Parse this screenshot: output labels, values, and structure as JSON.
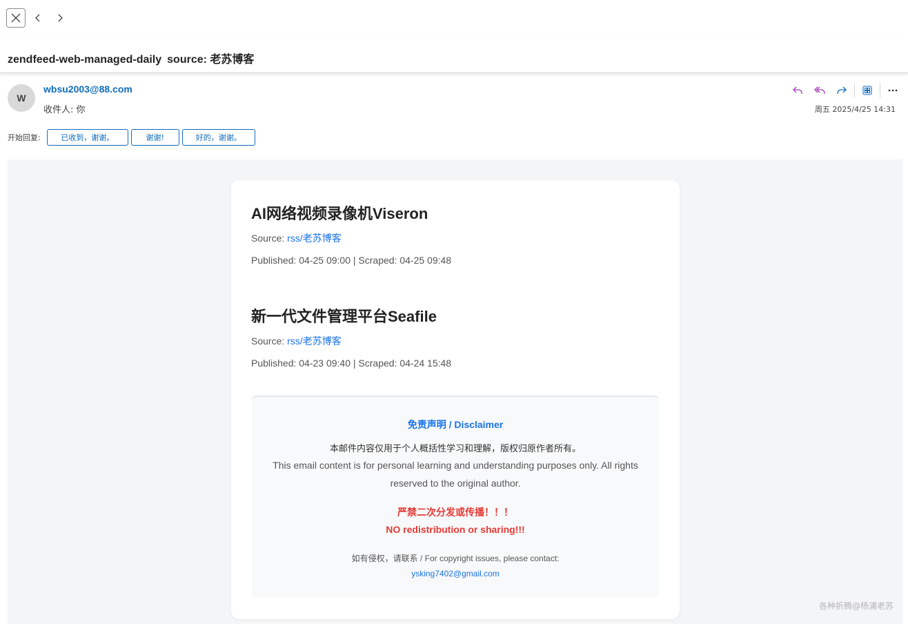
{
  "subject": {
    "title": "zendfeed-web-managed-daily",
    "source": "source: 老苏博客"
  },
  "header": {
    "avatar_initial": "W",
    "sender": "wbsu2003@88.com",
    "recipients": "收件人: 你",
    "datetime": "周五 2025/4/25 14:31"
  },
  "quick_replies": {
    "label": "开始回复:",
    "options": [
      "已收到，谢谢。",
      "谢谢!",
      "好的，谢谢。"
    ]
  },
  "articles": [
    {
      "title": "AI网络视频录像机Viseron",
      "source_label": "Source:",
      "source_link": "rss/老苏博客",
      "meta": "Published: 04-25 09:00 | Scraped: 04-25 09:48"
    },
    {
      "title": "新一代文件管理平台Seafile",
      "source_label": "Source:",
      "source_link": "rss/老苏博客",
      "meta": "Published: 04-23 09:40 | Scraped: 04-24 15:48"
    }
  ],
  "disclaimer": {
    "title": "免责声明 / Disclaimer",
    "text_zh": "本邮件内容仅用于个人概括性学习和理解，版权归原作者所有。",
    "text_en": "This email content is for personal learning and understanding purposes only. All rights reserved to the original author.",
    "warning_zh": "严禁二次分发或传播！！！",
    "warning_en": "NO redistribution or sharing!!!",
    "contact": "如有侵权，请联系 / For copyright issues, please contact:",
    "email": "ysking7402@gmail.com"
  },
  "watermark": "各种折腾@杨浦老苏",
  "icons": {
    "close": "close-icon",
    "back": "chevron-left-icon",
    "forward": "chevron-right-icon",
    "reply": "reply-icon",
    "reply_all": "reply-all-icon",
    "forward_mail": "forward-icon",
    "apps": "apps-icon",
    "more": "more-icon"
  },
  "colors": {
    "link": "#0f6cbd",
    "action_purple": "#a23cb7",
    "body_bg": "#f4f5f7",
    "accent_blue": "#1a73e8",
    "warning_red": "#e53935"
  }
}
